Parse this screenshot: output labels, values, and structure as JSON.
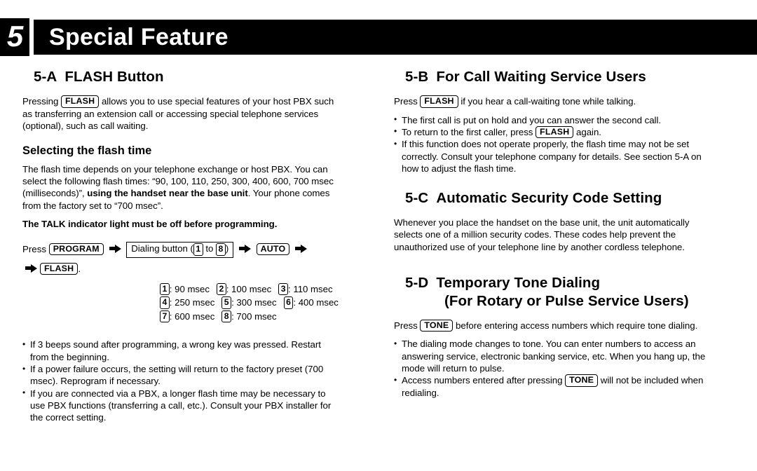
{
  "chapter": {
    "number": "5",
    "title": "Special Feature"
  },
  "left_column": {
    "section_a": {
      "id": "5-A",
      "title": "FLASH Button",
      "intro_pre": "Pressing ",
      "intro_key": "FLASH",
      "intro_post": " allows you to use special features of your host PBX such as transferring an extension call or accessing special telephone services (optional), such as call waiting.",
      "sub_head": "Selecting the flash time",
      "para1_a": "The flash time depends on your telephone exchange or host PBX. You can select the following flash times: “90, 100, 110, 250, 300, 400, 600, 700 msec (milliseconds)”, ",
      "para1_bold": "using the handset near the base unit",
      "para1_b": ". Your phone comes from the factory set to “700 msec”.",
      "warning": "The TALK indicator light must be off before programming.",
      "seq_press_label": "Press",
      "seq_key_program": "PROGRAM",
      "seq_dial_pre": "Dialing button (",
      "seq_dial_num1": "1",
      "seq_dial_to": " to ",
      "seq_dial_num2": "8",
      "seq_dial_post": ")",
      "seq_key_auto": "AUTO",
      "seq_key_flash": "FLASH",
      "seq_period": ".",
      "msec_rows": [
        [
          {
            "key": "1",
            "value": ": 90 msec"
          },
          {
            "key": "2",
            "value": ": 100 msec"
          },
          {
            "key": "3",
            "value": ": 110 msec"
          }
        ],
        [
          {
            "key": "4",
            "value": ": 250 msec"
          },
          {
            "key": "5",
            "value": ": 300 msec"
          },
          {
            "key": "6",
            "value": ": 400 msec"
          }
        ],
        [
          {
            "key": "7",
            "value": ": 600 msec"
          },
          {
            "key": "8",
            "value": ": 700 msec"
          }
        ]
      ],
      "bullets": [
        "If 3 beeps sound after programming, a wrong key was pressed. Restart from the beginning.",
        "If a power failure occurs, the setting will return to the factory preset (700 msec). Reprogram if necessary.",
        "If you are connected via a PBX, a longer flash time may be necessary to use PBX functions (transferring a call, etc.). Consult your PBX installer for the correct setting."
      ]
    }
  },
  "right_column": {
    "section_b": {
      "id": "5-B",
      "title": "For Call Waiting Service Users",
      "intro_pre": "Press ",
      "intro_key": "FLASH",
      "intro_post": " if you hear a call-waiting tone while talking.",
      "bullet1": "The first call is put on hold and you can answer the second call.",
      "bullet2_pre": "To return to the first caller, press ",
      "bullet2_key": "FLASH",
      "bullet2_post": " again.",
      "bullet3": "If this function does not operate properly, the flash time may not be set correctly. Consult your telephone company for details. See section 5-A on how to adjust the flash time."
    },
    "section_c": {
      "id": "5-C",
      "title": "Automatic Security Code Setting",
      "para": "Whenever you place the handset on the base unit, the unit automatically selects one of a million security codes. These codes help prevent the unauthorized use of your telephone line by another cordless telephone."
    },
    "section_d": {
      "id": "5-D",
      "title": "Temporary Tone Dialing",
      "subtitle": "(For Rotary or Pulse Service Users)",
      "intro_pre": "Press ",
      "intro_key": "TONE",
      "intro_post": " before entering access numbers which require tone dialing.",
      "bullet1": "The dialing mode changes to tone. You can enter numbers to access an answering service, electronic banking service, etc. When you hang up, the mode will return to pulse.",
      "bullet2_pre": "Access numbers entered after pressing ",
      "bullet2_key": "TONE",
      "bullet2_post": " will not be included when redialing."
    }
  }
}
